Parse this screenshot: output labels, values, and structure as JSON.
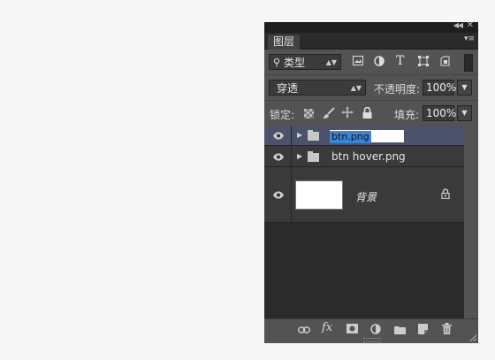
{
  "panel": {
    "tab_label": "图层",
    "filter": {
      "kind": "类型"
    },
    "blend": {
      "mode": "穿透",
      "opacity_label": "不透明度:",
      "opacity_value": "100%"
    },
    "lock": {
      "label": "锁定:",
      "fill_label": "填充:",
      "fill_value": "100%"
    },
    "layers": [
      {
        "name": "btn.png",
        "type": "group",
        "selected": true,
        "renaming": true
      },
      {
        "name": "btn hover.png",
        "type": "group",
        "selected": false
      },
      {
        "name": "背景",
        "type": "background",
        "locked": true
      }
    ],
    "bottom_icons": [
      "link-icon",
      "fx-icon",
      "mask-icon",
      "adjustment-icon",
      "new-group-icon",
      "new-layer-icon",
      "trash-icon"
    ],
    "fx_label": "fx"
  },
  "colors": {
    "panel_bg": "#535353",
    "layers_bg": "#2b2b2b",
    "selected_row": "#4a5369",
    "selection": "#3a86d6"
  }
}
